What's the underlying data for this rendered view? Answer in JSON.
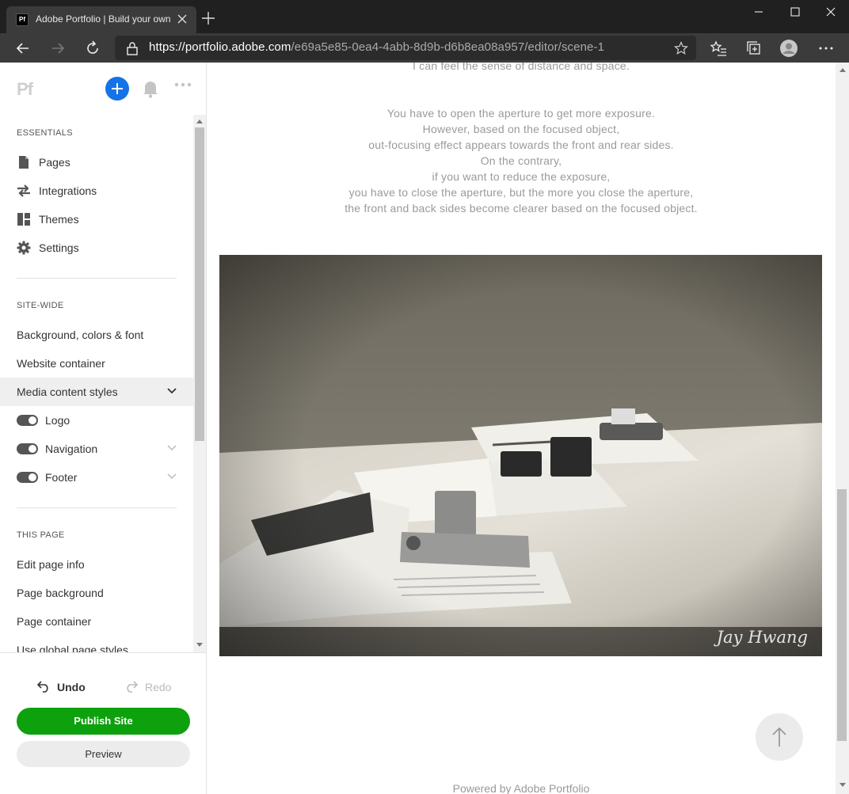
{
  "browser": {
    "tab_title": "Adobe Portfolio | Build your own",
    "favicon_text": "Pf",
    "url_host": "https://portfolio.adobe.com",
    "url_path": "/e69a5e85-0ea4-4abb-8d9b-d6b8ea08a957/editor/scene-1"
  },
  "panel": {
    "logo": "Pf",
    "essentials": {
      "heading": "ESSENTIALS",
      "items": [
        {
          "label": "Pages",
          "icon": "page-icon"
        },
        {
          "label": "Integrations",
          "icon": "integrations-icon"
        },
        {
          "label": "Themes",
          "icon": "themes-icon"
        },
        {
          "label": "Settings",
          "icon": "gear-icon"
        }
      ]
    },
    "sitewide": {
      "heading": "SITE-WIDE",
      "items": [
        "Background, colors & font",
        "Website container",
        "Media content styles"
      ],
      "toggles": [
        {
          "label": "Logo",
          "on": true
        },
        {
          "label": "Navigation",
          "on": true
        },
        {
          "label": "Footer",
          "on": true
        }
      ]
    },
    "thispage": {
      "heading": "THIS PAGE",
      "items": [
        "Edit page info",
        "Page background",
        "Page container",
        "Use global page styles"
      ]
    },
    "undo_label": "Undo",
    "redo_label": "Redo",
    "publish_label": "Publish Site",
    "preview_label": "Preview"
  },
  "content": {
    "partial_line": "I can feel the sense of distance and space.",
    "paragraph": [
      "You have to open the aperture to get more exposure.",
      "However, based on the focused object,",
      "out-focusing effect appears towards the front and rear sides.",
      "On the contrary,",
      "if you want to reduce the exposure,",
      "you have to close the aperture, but the more you close the aperture,",
      "the front and back sides become clearer based on the focused object."
    ],
    "photo_watermark": "Jay Hwang",
    "footer": "Powered by Adobe Portfolio"
  },
  "colors": {
    "accent_blue": "#1473e6",
    "publish_green": "#0ea10e"
  }
}
